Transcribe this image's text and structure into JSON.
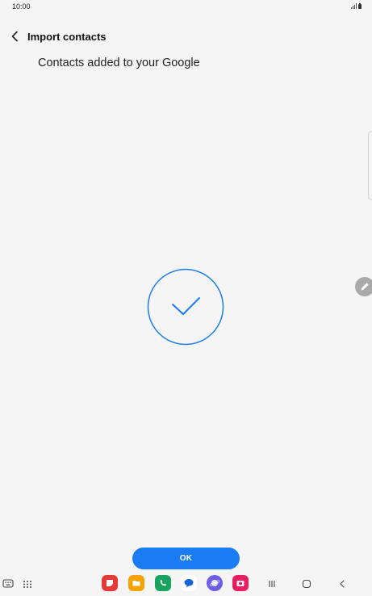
{
  "status_bar": {
    "time": "10:00",
    "icons": [
      "signal-icon",
      "battery-icon"
    ]
  },
  "header": {
    "back_icon": "chevron-left-icon",
    "title": "Import contacts"
  },
  "main": {
    "message": "Contacts added to your Google",
    "success_icon": "checkmark-circle-icon",
    "accent_color": "#1a7cf5"
  },
  "side": {
    "edit_icon": "pencil-icon"
  },
  "footer": {
    "ok_label": "OK"
  },
  "nav_bar": {
    "left_icons": [
      "keyboard-icon",
      "app-drawer-icon"
    ],
    "apps": [
      {
        "name": "notes-app-icon",
        "color": "#e53935"
      },
      {
        "name": "my-files-app-icon",
        "color": "#f5a300"
      },
      {
        "name": "phone-app-icon",
        "color": "#1aa260"
      },
      {
        "name": "messages-app-icon",
        "color": "#1565d8"
      },
      {
        "name": "internet-app-icon",
        "color": "#6c5ce7"
      },
      {
        "name": "camera-app-icon",
        "color": "#e91e63"
      }
    ],
    "system_buttons": [
      "recents-button",
      "home-button",
      "back-button"
    ]
  }
}
